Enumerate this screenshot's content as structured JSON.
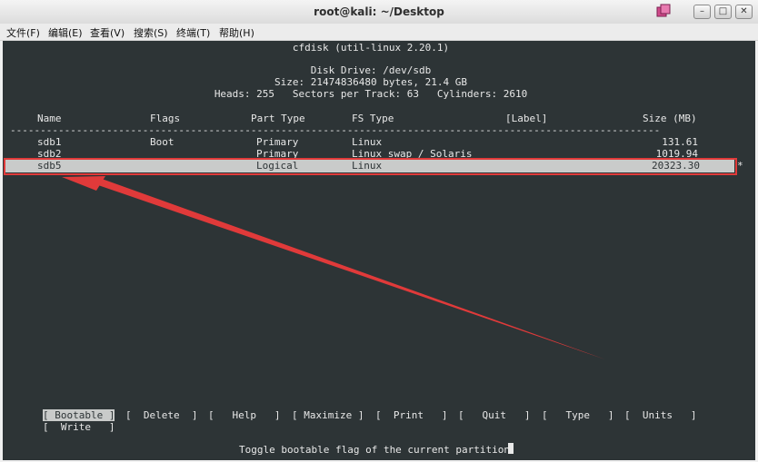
{
  "window": {
    "title": "root@kali: ~/Desktop",
    "controls": {
      "minimize": "–",
      "maximize": "□",
      "close": "✕"
    }
  },
  "menubar": [
    "文件(F)",
    "编辑(E)",
    "查看(V)",
    "搜索(S)",
    "终端(T)",
    "帮助(H)"
  ],
  "cfdisk": {
    "header": "cfdisk (util-linux 2.20.1)",
    "disk_drive": "Disk Drive: /dev/sdb",
    "size_line": "Size: 21474836480 bytes, 21.4 GB",
    "geometry_line": "Heads: 255   Sectors per Track: 63   Cylinders: 2610",
    "columns": {
      "name": "Name",
      "flags": "Flags",
      "part_type": "Part Type",
      "fs_type": "FS Type",
      "label": "[Label]",
      "size": "Size (MB)"
    },
    "separator": "------------------------------------------------------------------------------------------------------------",
    "partitions": [
      {
        "name": "sdb1",
        "flags": "Boot",
        "part_type": "Primary",
        "fs_type": "Linux",
        "label": "",
        "size": "131.61"
      },
      {
        "name": "sdb2",
        "flags": "",
        "part_type": "Primary",
        "fs_type": "Linux swap / Solaris",
        "label": "",
        "size": "1019.94"
      },
      {
        "name": "sdb5",
        "flags": "",
        "part_type": "Logical",
        "fs_type": "Linux",
        "label": "",
        "size": "20323.30"
      }
    ],
    "selected_marker": "*",
    "actions": [
      "[ Bootable ]",
      "[  Delete  ]",
      "[   Help   ]",
      "[ Maximize ]",
      "[  Print   ]",
      "[   Quit   ]",
      "[   Type   ]",
      "[  Units   ]",
      "[  Write   ]"
    ],
    "status": "Toggle bootable flag of the current partition"
  },
  "colors": {
    "terminal_bg": "#2d3436",
    "highlight": "#c9cbca",
    "annotation": "#e03a3a"
  }
}
